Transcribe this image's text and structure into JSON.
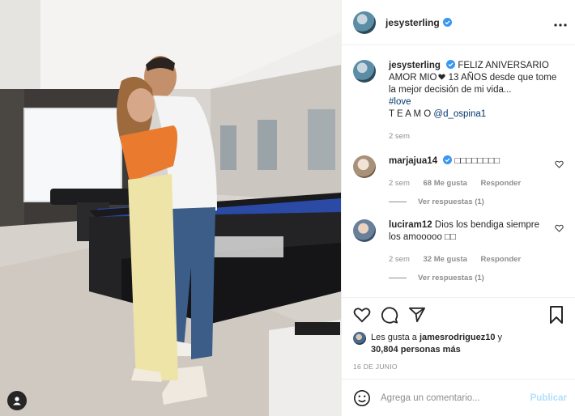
{
  "post": {
    "author": {
      "username": "jesysterling",
      "verified": true
    },
    "caption": {
      "username": "jesysterling",
      "text_line1": "FELIZ ANIVERSARIO AMOR MIO",
      "text_line2": " 13 AÑOS desde que tome la mejor decisión de mi vida...",
      "hashtag": "#love",
      "text_line3": "T E A M O ",
      "mention": "@d_ospina1",
      "time": "2 sem"
    },
    "comments": [
      {
        "username": "marjajua14",
        "verified": true,
        "text": "□□□□□□□□",
        "time": "2 sem",
        "likes": "68 Me gusta",
        "reply_label": "Responder",
        "view_replies": "Ver respuestas (1)"
      },
      {
        "username": "luciram12",
        "verified": false,
        "text": "Dios los bendiga siempre los amooooo □□",
        "time": "2 sem",
        "likes": "32 Me gusta",
        "reply_label": "Responder",
        "view_replies": "Ver respuestas (1)"
      }
    ],
    "likes": {
      "prefix": "Les gusta a ",
      "user": "jamesrodriguez10",
      "connector": " y",
      "count": "30,804 personas más"
    },
    "date": "16 DE JUNIO",
    "add_comment": {
      "placeholder": "Agrega un comentario...",
      "publish_label": "Publicar"
    },
    "icons": {
      "more": "more-options-icon",
      "like": "heart-icon",
      "comment": "comment-bubble-icon",
      "share": "paper-plane-icon",
      "save": "bookmark-icon",
      "emoji": "emoji-smiley-icon",
      "user_tags": "user-tags-icon"
    },
    "colors": {
      "link": "#00376b",
      "verified": "#3897f0",
      "muted": "#8e8e8e",
      "publish_disabled": "#b2dffc"
    }
  }
}
